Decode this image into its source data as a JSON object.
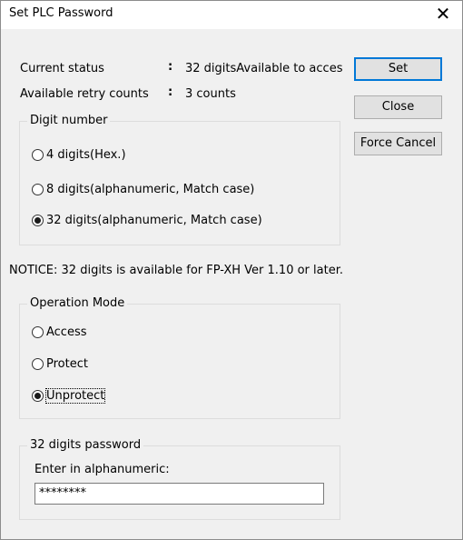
{
  "window": {
    "title": "Set PLC Password",
    "close_glyph": "✕"
  },
  "status": {
    "current_status_label": "Current status",
    "current_status_colon": ":",
    "current_status_value": "32 digitsAvailable to acces",
    "retry_label": "Available retry counts",
    "retry_colon": ":",
    "retry_value": "3 counts"
  },
  "buttons": {
    "set": "Set",
    "close": "Close",
    "force_cancel": "Force Cancel"
  },
  "digit_number": {
    "legend": "Digit number",
    "options": [
      {
        "label": "4 digits(Hex.)",
        "checked": false
      },
      {
        "label": "8 digits(alphanumeric, Match case)",
        "checked": false
      },
      {
        "label": "32 digits(alphanumeric, Match case)",
        "checked": true
      }
    ]
  },
  "notice": "NOTICE: 32 digits is available for FP-XH Ver 1.10 or later.",
  "operation_mode": {
    "legend": "Operation Mode",
    "options": [
      {
        "label": "Access",
        "checked": false
      },
      {
        "label": "Protect",
        "checked": false
      },
      {
        "label": "Unprotect",
        "checked": true
      }
    ]
  },
  "password": {
    "legend": "32 digits password",
    "prompt": "Enter in alphanumeric:",
    "value": "********"
  }
}
